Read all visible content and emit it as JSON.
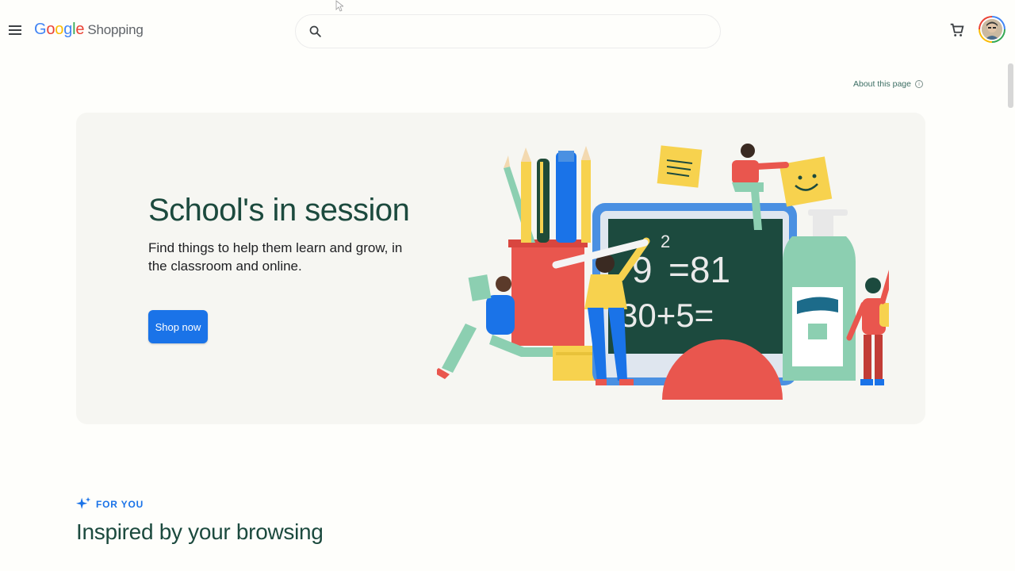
{
  "header": {
    "logo": {
      "g1": "G",
      "o1": "o",
      "o2": "o",
      "g2": "g",
      "l": "l",
      "e": "e",
      "product": "Shopping"
    },
    "search": {
      "placeholder": "",
      "value": ""
    },
    "icons": {
      "menu": "menu-icon",
      "search": "search-icon",
      "cart": "cart-icon",
      "avatar": "account-avatar"
    }
  },
  "about": {
    "label": "About this page",
    "icon": "info-icon"
  },
  "hero": {
    "title": "School's in session",
    "subtitle": "Find things to help them learn and grow, in the classroom and online.",
    "cta": "Shop now",
    "chalkboard": {
      "line1": "9",
      "exp": "2",
      "eq1": "=81",
      "line2": "30+5="
    }
  },
  "section": {
    "eyebrow": "FOR YOU",
    "eyebrow_icon": "sparkle-icon",
    "title": "Inspired by your browsing"
  },
  "colors": {
    "accent": "#1a73e8",
    "heading": "#1c4a3e",
    "background": "#fefefb",
    "hero_bg": "#f6f6f2"
  }
}
